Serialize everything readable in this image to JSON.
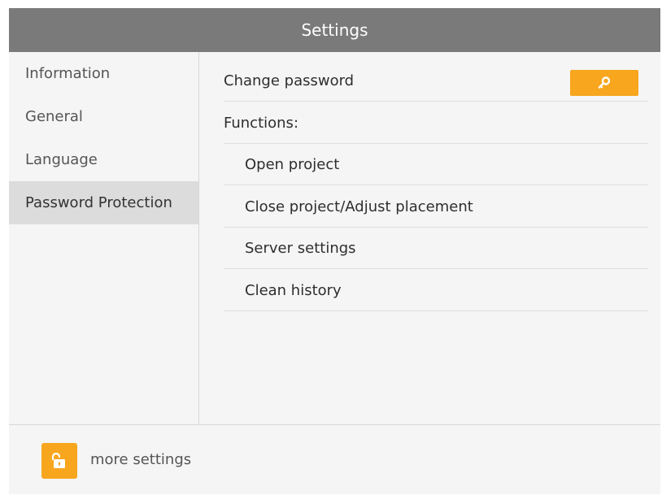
{
  "window": {
    "title": "Settings"
  },
  "sidebar": {
    "items": [
      {
        "label": "Information",
        "active": false
      },
      {
        "label": "General",
        "active": false
      },
      {
        "label": "Language",
        "active": false
      },
      {
        "label": "Password Protection",
        "active": true
      }
    ]
  },
  "main": {
    "change_password_label": "Change password",
    "change_password_icon": "key-icon",
    "functions_label": "Functions:",
    "functions": [
      {
        "label": "Open project"
      },
      {
        "label": "Close project/Adjust placement"
      },
      {
        "label": "Server settings"
      },
      {
        "label": "Clean history"
      }
    ]
  },
  "footer": {
    "more_settings_label": "more settings",
    "lock_icon": "unlocked-padlock-icon"
  },
  "colors": {
    "accent": "#f7a61e",
    "titlebar": "#7a7a7a",
    "background": "#f5f5f5",
    "active_item": "#dcdcdc"
  }
}
